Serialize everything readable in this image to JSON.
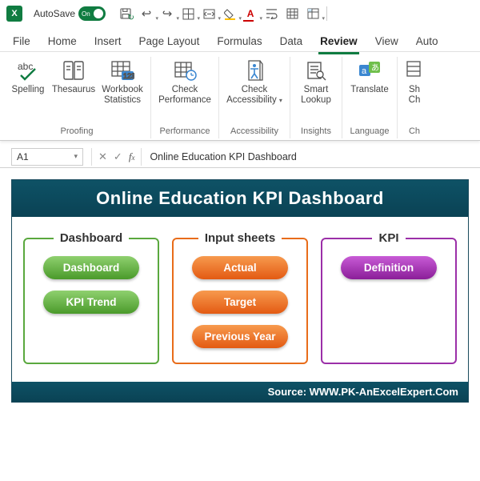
{
  "titlebar": {
    "autosave_label": "AutoSave",
    "autosave_state": "On"
  },
  "tabs": [
    "File",
    "Home",
    "Insert",
    "Page Layout",
    "Formulas",
    "Data",
    "Review",
    "View",
    "Auto"
  ],
  "active_tab": "Review",
  "ribbon": {
    "proofing": {
      "title": "Proofing",
      "spelling": "Spelling",
      "thesaurus": "Thesaurus",
      "stats": "Workbook Statistics"
    },
    "performance": {
      "title": "Performance",
      "btn": "Check Performance"
    },
    "accessibility": {
      "title": "Accessibility",
      "btn": "Check Accessibility"
    },
    "insights": {
      "title": "Insights",
      "btn": "Smart Lookup"
    },
    "language": {
      "title": "Language",
      "btn": "Translate"
    },
    "changes": {
      "title": "Ch",
      "btn": "Sh\nCh"
    }
  },
  "formula": {
    "cell": "A1",
    "value": "Online Education KPI Dashboard"
  },
  "dashboard": {
    "title": "Online Education KPI Dashboard",
    "footer": "Source: WWW.PK-AnExcelExpert.Com",
    "cards": {
      "dashboard": {
        "legend": "Dashboard",
        "items": [
          "Dashboard",
          "KPI Trend"
        ]
      },
      "input": {
        "legend": "Input sheets",
        "items": [
          "Actual",
          "Target",
          "Previous Year"
        ]
      },
      "kpi": {
        "legend": "KPI",
        "items": [
          "Definition"
        ]
      }
    }
  }
}
